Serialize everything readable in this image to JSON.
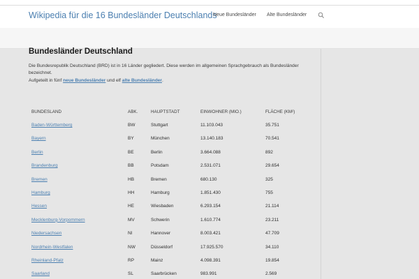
{
  "header": {
    "site_title": "Wikipedia für die 16 Bundesländer Deutschlands",
    "nav": [
      "Neue Bundesländer",
      "Alte Bundesländer"
    ],
    "search_icon": "search-icon"
  },
  "main": {
    "title": "Bundesländer Deutschland",
    "intro_line1": "Die Bundesrepublik Deutschland (BRD) ist in 16 Länder gegliedert. Diese werden im allgemeinen Sprachgebrauch als Bundesländer bezeichnet.",
    "intro_line2_pre": "Aufgeteilt in fünf ",
    "intro_link_new": "neue Bundesländer",
    "intro_line2_mid": " und elf ",
    "intro_link_old": "alte Bundesländer",
    "intro_line2_post": "."
  },
  "table": {
    "headers": [
      "Bundesland",
      "Abk.",
      "Hauptstadt",
      "Einwohner (Mio.)",
      "Fläche (km²)"
    ],
    "rows": [
      [
        "Baden-Württemberg",
        "BW",
        "Stuttgart",
        "11.103.043",
        "35.751"
      ],
      [
        "Bayern",
        "BY",
        "München",
        "13.140.183",
        "70.541"
      ],
      [
        "Berlin",
        "BE",
        "Berlin",
        "3.664.088",
        "892"
      ],
      [
        "Brandenburg",
        "BB",
        "Potsdam",
        "2.531.071",
        "29.654"
      ],
      [
        "Bremen",
        "HB",
        "Bremen",
        "680.130",
        "325"
      ],
      [
        "Hamburg",
        "HH",
        "Hamburg",
        "1.851.430",
        "755"
      ],
      [
        "Hessen",
        "HE",
        "Wiesbaden",
        "6.293.154",
        "21.114"
      ],
      [
        "Mecklenburg-Vorpommern",
        "MV",
        "Schwerin",
        "1.610.774",
        "23.211"
      ],
      [
        "Niedersachsen",
        "NI",
        "Hannover",
        "8.003.421",
        "47.709"
      ],
      [
        "Nordrhein-Westfalen",
        "NW",
        "Düsseldorf",
        "17.925.570",
        "34.110"
      ],
      [
        "Rheinland-Pfalz",
        "RP",
        "Mainz",
        "4.098.391",
        "19.854"
      ],
      [
        "Saarland",
        "SL",
        "Saarbrücken",
        "983.991",
        "2.569"
      ]
    ]
  }
}
